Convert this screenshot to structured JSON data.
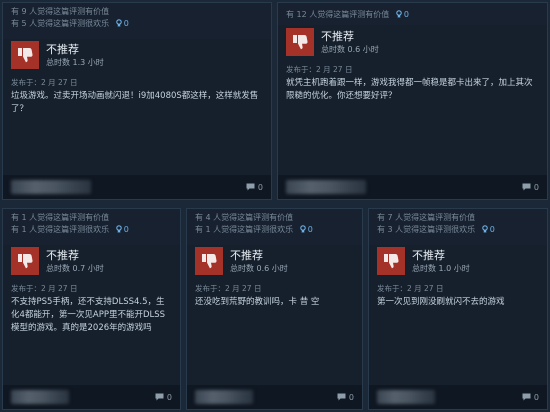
{
  "reviews": [
    {
      "helpful": "有 9 人觉得这篇评测有价值",
      "funny": "有 5 人觉得这篇评测很欢乐",
      "awards": "0",
      "verdict": "不推荐",
      "hours": "总时数 1.3 小时",
      "posted": "发布于：2 月 27 日",
      "text": "垃圾游戏。过卖开场动画就闪退！i9加4080S都这样，这样就发售了？",
      "comments": "0"
    },
    {
      "helpful": "有 12 人觉得这篇评测有价值",
      "funny": "",
      "awards": "0",
      "verdict": "不推荐",
      "hours": "总时数 0.6 小时",
      "posted": "发布于：2 月 27 日",
      "text": "就凭主机跑着跟一样，游戏我得都一帧稳是都卡出来了，加上其次限糙的优化。你还想要好评？",
      "comments": "0"
    },
    {
      "helpful": "有 1 人觉得这篇评测有价值",
      "funny": "有 1 人觉得这篇评测很欢乐",
      "awards": "0",
      "verdict": "不推荐",
      "hours": "总时数 0.7 小时",
      "posted": "发布于：2 月 27 日",
      "text": "不支持PS5手柄，还不支持DLSS4.5，生化4都能开，第一次见APP里不能开DLSS模型的游戏。真的是2026年的游戏吗",
      "comments": "0"
    },
    {
      "helpful": "有 4 人觉得这篇评测有价值",
      "funny": "有 1 人觉得这篇评测很欢乐",
      "awards": "0",
      "verdict": "不推荐",
      "hours": "总时数 0.6 小时",
      "posted": "发布于：2 月 27 日",
      "text": "还没吃到荒野的教训吗，卡 昔 空",
      "comments": "0"
    },
    {
      "helpful": "有 7 人觉得这篇评测有价值",
      "funny": "有 3 人觉得这篇评测很欢乐",
      "awards": "0",
      "verdict": "不推荐",
      "hours": "总时数 1.0 小时",
      "posted": "发布于：2 月 27 日",
      "text": "第一次见到刚没刷就闪不去的游戏",
      "comments": "0"
    }
  ],
  "colors": {
    "page_bg": "#1b2838",
    "card_bg": "#16202d",
    "thumb_red": "#a53228",
    "award_blue": "#6fb1e6"
  }
}
